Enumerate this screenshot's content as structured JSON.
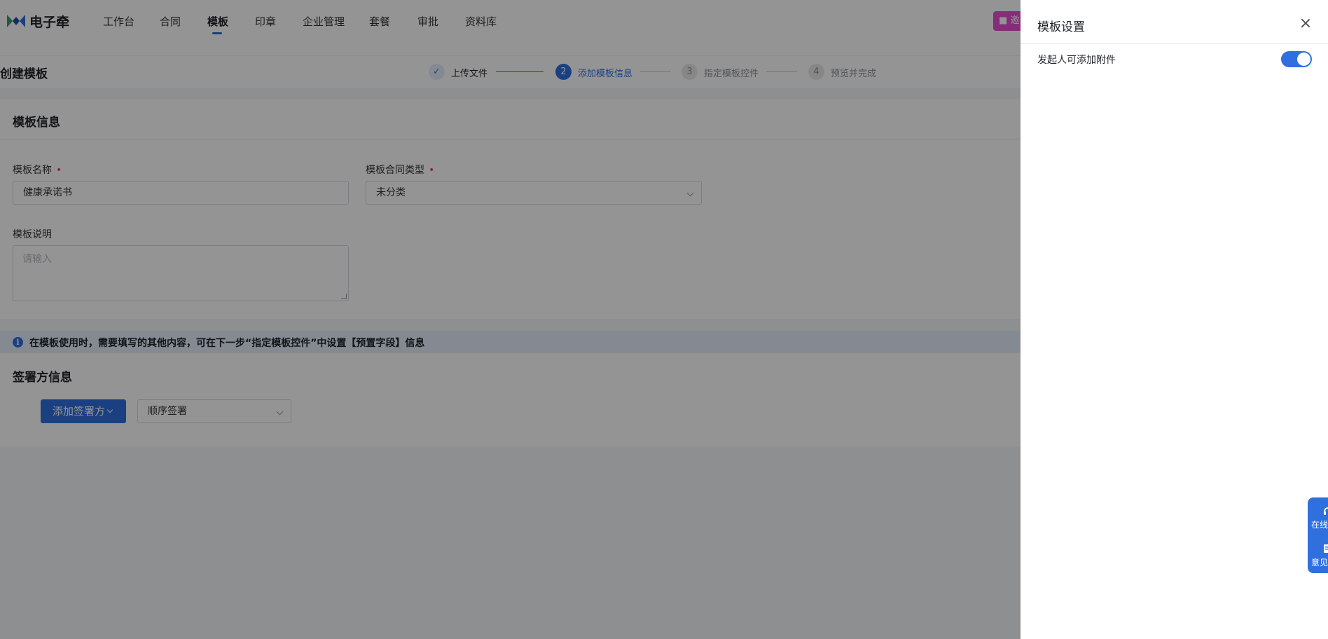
{
  "brand": {
    "name": "电子牵"
  },
  "nav": {
    "items": [
      "工作台",
      "合同",
      "模板",
      "印章",
      "企业管理",
      "套餐",
      "审批",
      "资料库"
    ],
    "active": "模板",
    "promo_label": "邀"
  },
  "steps": {
    "page_title": "创建模板",
    "items": [
      {
        "index": "",
        "label": "上传文件",
        "state": "done"
      },
      {
        "index": "2",
        "label": "添加模板信息",
        "state": "current"
      },
      {
        "index": "3",
        "label": "指定模板控件",
        "state": "todo"
      },
      {
        "index": "4",
        "label": "预览并完成",
        "state": "todo"
      }
    ]
  },
  "template_info": {
    "title": "模板信息",
    "name_label": "模板名称",
    "name_value": "健康承诺书",
    "type_label": "模板合同类型",
    "type_value": "未分类",
    "desc_label": "模板说明",
    "desc_placeholder": "请输入",
    "required_mark": "•"
  },
  "notice": {
    "icon": "info-icon",
    "text": "在模板使用时，需要填写的其他内容，可在下一步“指定模板控件”中设置【预置字段】信息"
  },
  "signers": {
    "title": "签署方信息",
    "add_button": "添加签署方",
    "order_value": "顺序签署"
  },
  "drawer": {
    "title": "模板设置",
    "setting_label": "发起人可添加附件",
    "setting_enabled": true
  },
  "float_help": {
    "online_label": "在线",
    "feedback_label": "意见"
  },
  "colors": {
    "primary": "#2f6fde",
    "promo": "#e64fd0",
    "required": "#e34d59"
  }
}
